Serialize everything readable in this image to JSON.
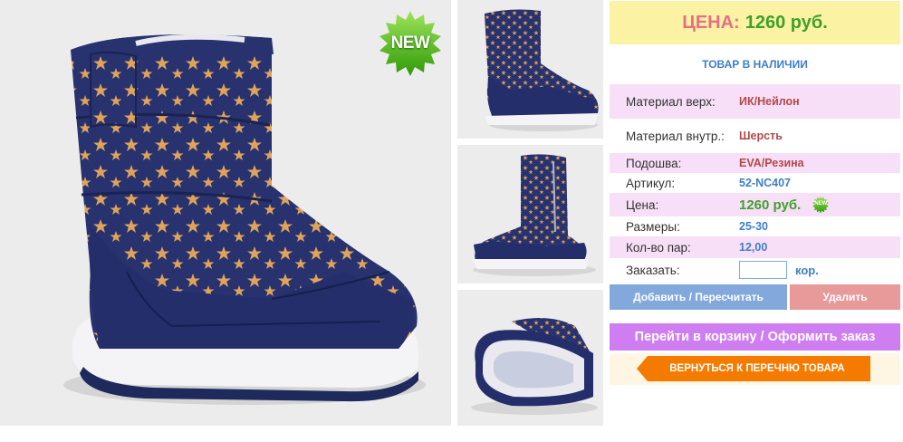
{
  "badge": {
    "main": "NEW",
    "mini": "NEW"
  },
  "price_box": {
    "label": "ЦЕНА:",
    "value": "1260 руб."
  },
  "stock_status": "ТОВАР В НАЛИЧИИ",
  "specs": [
    {
      "label": "Материал верх:",
      "value": "ИК/Нейлон"
    },
    {
      "label": "Материал внутр.:",
      "value": "Шерсть"
    },
    {
      "label": "Подошва:",
      "value": "EVA/Резина"
    },
    {
      "label": "Артикул:",
      "value": "52-NC407"
    },
    {
      "label": "Цена:",
      "value": "1260 руб."
    },
    {
      "label": "Размеры:",
      "value": "25-30"
    },
    {
      "label": "Кол-во пар:",
      "value": "12,00"
    },
    {
      "label": "Заказать:",
      "value": "кор.",
      "input_value": ""
    }
  ],
  "buttons": {
    "add": "Добавить / Пересчитать",
    "delete": "Удалить",
    "cart": "Перейти в корзину / Оформить заказ",
    "back": "ВЕРНУТЬСЯ К ПЕРЕЧНЮ ТОВАРА"
  },
  "colors": {
    "price_bg": "#fbf3a3",
    "price_label": "#e76f83",
    "price_value": "#3ea12b",
    "spec_pink": "#f7dff7",
    "btn_add": "#82a8dc",
    "btn_delete": "#e89999",
    "btn_cart": "#cf7ef2",
    "btn_back": "#f57b00",
    "boot_navy": "#232f6b",
    "boot_star": "#e0a35a"
  },
  "icons": [
    "new-badge-icon",
    "boot-product-image",
    "back-arrow-icon"
  ]
}
